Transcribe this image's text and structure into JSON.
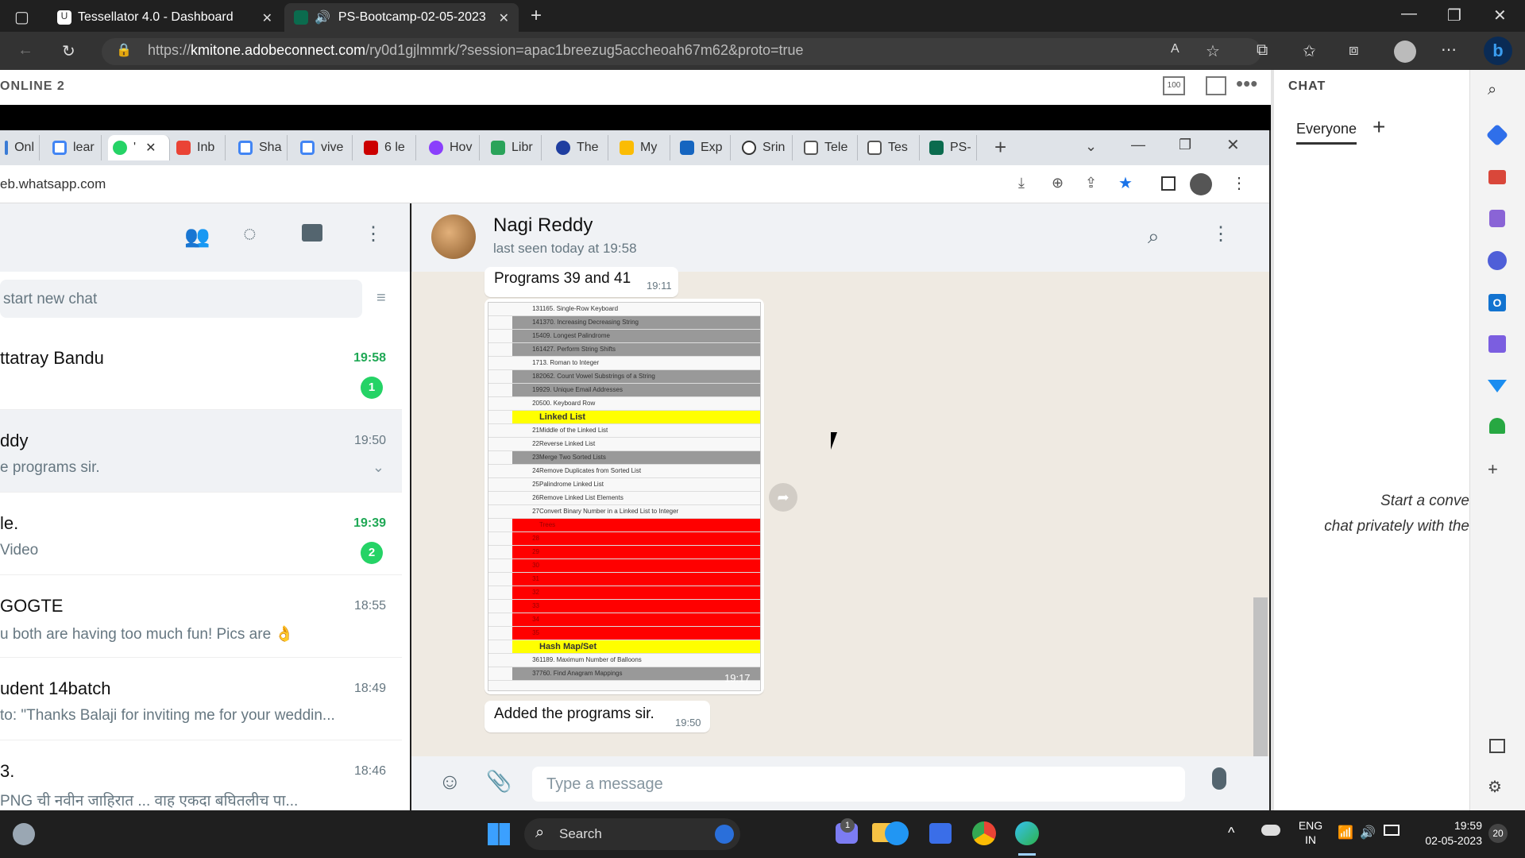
{
  "browser": {
    "tabs": [
      {
        "title": "Tessellator 4.0 - Dashboard"
      },
      {
        "title": "PS-Bootcamp-02-05-2023"
      }
    ],
    "url_prefix": "https://",
    "url_domain": "kmitone.adobeconnect.com",
    "url_rest": "/ry0d1gjlmmrk/?session=apac1breezug5accheoah67m62&proto=true"
  },
  "adobe_connect": {
    "online_label": "ONLINE 2",
    "zoom_label": "100",
    "chat": {
      "title": "CHAT",
      "tab_everyone": "Everyone",
      "add_label": "+",
      "empty_line1": "Start a conve",
      "empty_line2": "chat privately with the"
    }
  },
  "inner_browser": {
    "tabs": [
      "Onl",
      "lear",
      "'",
      "Inb",
      "Sha",
      "vive",
      "6 le",
      "Hov",
      "Libr",
      "The",
      "My",
      "Exp",
      "Srin",
      "Tele",
      "Tes",
      "PS-"
    ],
    "url": "eb.whatsapp.com"
  },
  "whatsapp": {
    "search_placeholder": "start new chat",
    "chats": [
      {
        "name": "ttatray Bandu",
        "preview": "",
        "time": "19:58",
        "unread": "1"
      },
      {
        "name": "ddy",
        "preview": "e programs sir.",
        "time": "19:50",
        "unread": ""
      },
      {
        "name": "le.",
        "preview": "Video",
        "time": "19:39",
        "unread": "2"
      },
      {
        "name": "GOGTE",
        "preview": "u both are having too much fun! Pics are 👌",
        "time": "18:55",
        "unread": ""
      },
      {
        "name": "udent 14batch",
        "preview": "to: \"Thanks Balaji for inviting me for your weddin...",
        "time": "18:49",
        "unread": ""
      },
      {
        "name": "3.",
        "preview": "PNG ची नवीन जाहिरात ... वाह एकदा बघितलीच पा...",
        "time": "18:46",
        "unread": ""
      }
    ],
    "conversation": {
      "contact_name": "Nagi Reddy",
      "last_seen": "last seen today at 19:58",
      "messages": [
        {
          "text": "Programs 39 and 41",
          "time": "19:11"
        },
        {
          "text": "",
          "time": "19:17"
        },
        {
          "text": "Added the programs sir.",
          "time": "19:50"
        }
      ],
      "composer_placeholder": "Type a message"
    },
    "sheet_rows": [
      {
        "n": "13",
        "t": "1165. Single-Row Keyboard",
        "style": "plain"
      },
      {
        "n": "14",
        "t": "1370. Increasing Decreasing String",
        "style": "gray"
      },
      {
        "n": "15",
        "t": "409. Longest Palindrome",
        "style": "gray"
      },
      {
        "n": "16",
        "t": "1427. Perform String Shifts",
        "style": "gray"
      },
      {
        "n": "17",
        "t": "13. Roman to Integer",
        "style": "plain"
      },
      {
        "n": "18",
        "t": "2062. Count Vowel Substrings of a String",
        "style": "gray"
      },
      {
        "n": "19",
        "t": "929. Unique Email Addresses",
        "style": "gray"
      },
      {
        "n": "20",
        "t": "500. Keyboard Row",
        "style": "plain"
      },
      {
        "n": "",
        "t": "Linked List",
        "style": "yellow"
      },
      {
        "n": "21",
        "t": "Middle of the Linked List",
        "style": "plain"
      },
      {
        "n": "22",
        "t": "Reverse Linked List",
        "style": "plain"
      },
      {
        "n": "23",
        "t": "Merge Two Sorted Lists",
        "style": "gray"
      },
      {
        "n": "24",
        "t": "Remove Duplicates from Sorted List",
        "style": "plain"
      },
      {
        "n": "25",
        "t": "Palindrome Linked List",
        "style": "plain"
      },
      {
        "n": "26",
        "t": "Remove Linked List Elements",
        "style": "plain"
      },
      {
        "n": "27",
        "t": "Convert Binary Number in a Linked List to Integer",
        "style": "plain"
      },
      {
        "n": "",
        "t": "Trees",
        "style": "red"
      },
      {
        "n": "28",
        "t": "",
        "style": "red"
      },
      {
        "n": "29",
        "t": "",
        "style": "red"
      },
      {
        "n": "30",
        "t": "",
        "style": "red"
      },
      {
        "n": "31",
        "t": "",
        "style": "red"
      },
      {
        "n": "32",
        "t": "",
        "style": "red"
      },
      {
        "n": "33",
        "t": "",
        "style": "red"
      },
      {
        "n": "34",
        "t": "",
        "style": "red"
      },
      {
        "n": "35",
        "t": "",
        "style": "red"
      },
      {
        "n": "",
        "t": "Hash Map/Set",
        "style": "yellow"
      },
      {
        "n": "36",
        "t": "1189. Maximum Number of Balloons",
        "style": "plain"
      },
      {
        "n": "37",
        "t": "760. Find Anagram Mappings",
        "style": "gray"
      }
    ]
  },
  "taskbar": {
    "search_label": "Search",
    "lang": "ENG",
    "region": "IN",
    "time": "19:59",
    "date": "02-05-2023",
    "notif_count": "20"
  },
  "colors": {
    "whatsapp_green": "#25d366",
    "edge_blue": "#0078d4"
  }
}
